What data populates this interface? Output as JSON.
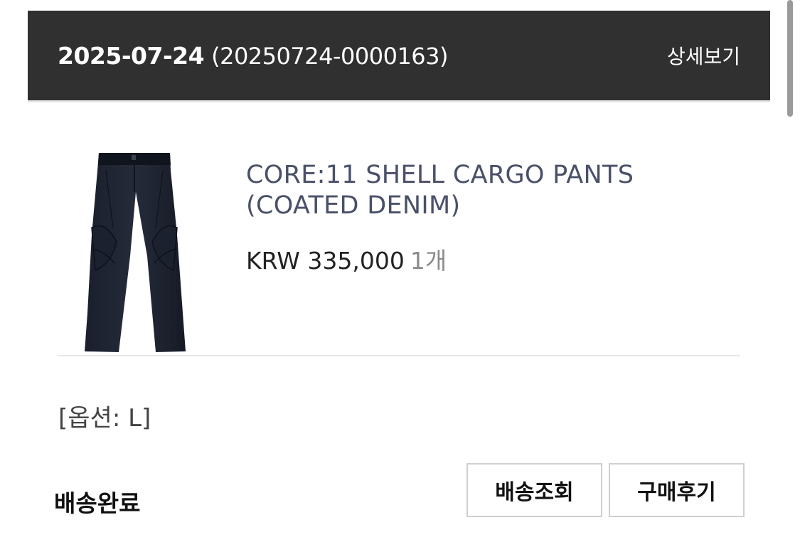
{
  "order": {
    "date": "2025-07-24",
    "number": "(20250724-0000163)",
    "detail_link": "상세보기"
  },
  "product": {
    "name_line1": "CORE:11 SHELL CARGO PANTS",
    "name_line2": "(COATED DENIM)",
    "price": "KRW 335,000",
    "quantity": "1개",
    "image": "pants-image",
    "option": "[옵션: L]"
  },
  "status": "배송완료",
  "buttons": {
    "track": "배송조회",
    "review": "구매후기"
  },
  "colors": {
    "header_bg": "#303030",
    "product_name": "#4a5068",
    "quantity": "#8a8a8a"
  }
}
